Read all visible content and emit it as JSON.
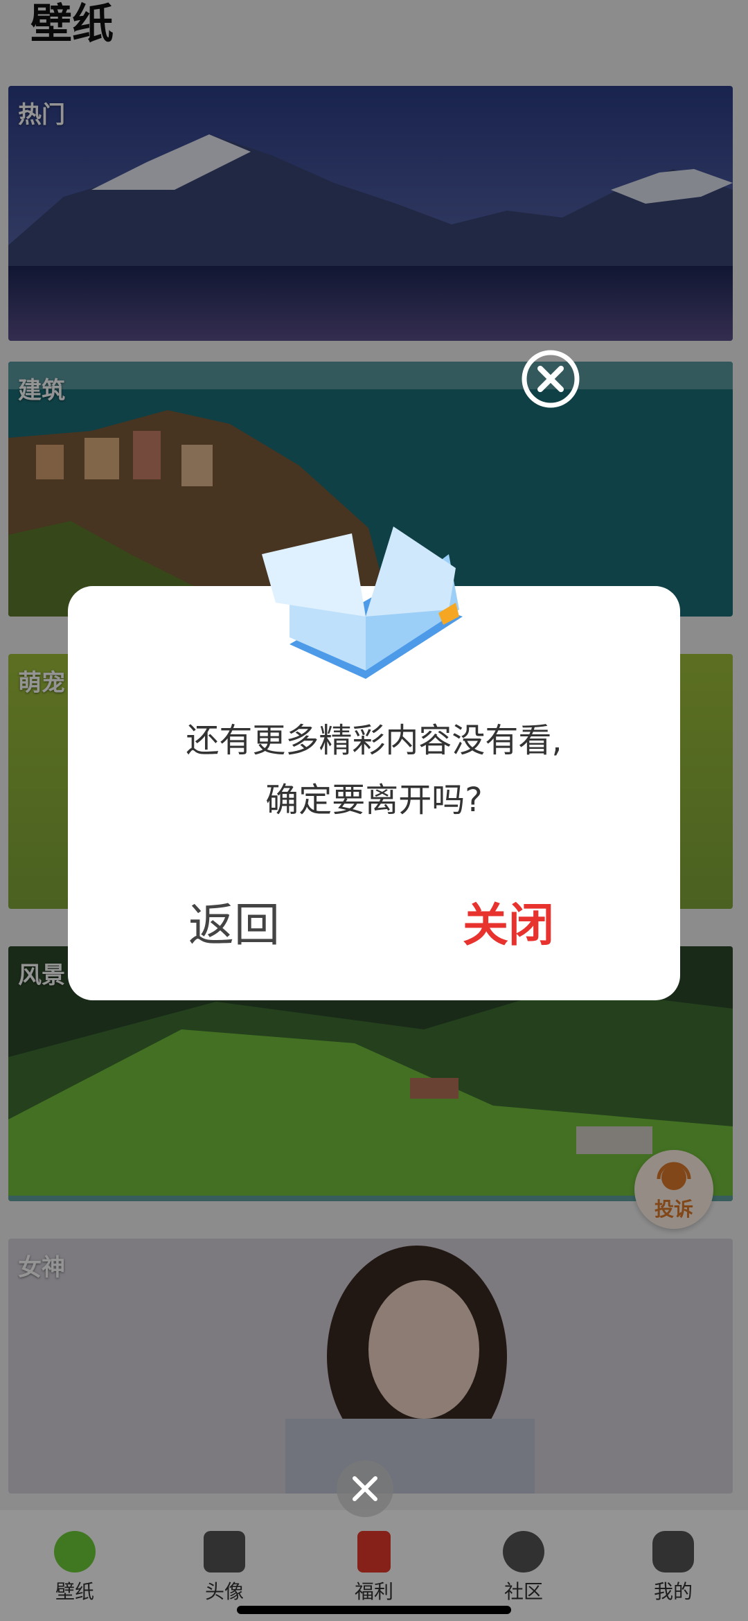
{
  "header": {
    "title": "壁纸"
  },
  "categories": [
    {
      "label": "热门"
    },
    {
      "label": "建筑"
    },
    {
      "label": "萌宠"
    },
    {
      "label": "风景"
    },
    {
      "label": "女神"
    }
  ],
  "complain_button": {
    "label": "投诉"
  },
  "dialog": {
    "message_line1": "还有更多精彩内容没有看,",
    "message_line2": "确定要离开吗?",
    "back_label": "返回",
    "close_label": "关闭"
  },
  "tabbar": {
    "items": [
      {
        "label": "壁纸",
        "icon": "lime-icon"
      },
      {
        "label": "头像",
        "icon": "camera-icon"
      },
      {
        "label": "福利",
        "icon": "red-envelope-icon"
      },
      {
        "label": "社区",
        "icon": "planet-icon"
      },
      {
        "label": "我的",
        "icon": "profile-icon"
      }
    ]
  },
  "colors": {
    "accent_red": "#e8322e",
    "complain_orange": "#e07a2a"
  }
}
